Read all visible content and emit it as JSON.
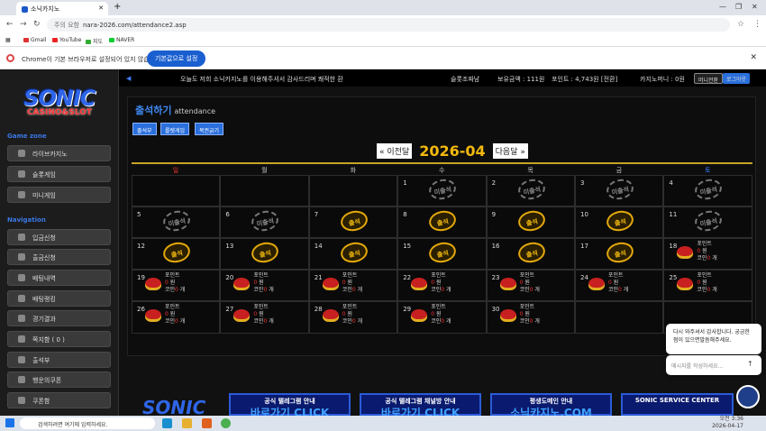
{
  "browser": {
    "tab_title": "소닉카지노",
    "url": "nara-2026.com/attendance2.asp",
    "security": "주의 요함"
  },
  "bookmarks": [
    "Gmail",
    "YouTube",
    "지도",
    "NAVER"
  ],
  "infobar": {
    "text": "Chrome이 기본 브라우저로 설정되어 있지 않습니다.",
    "button": "기본값으로 설정"
  },
  "logo": {
    "line1": "SONIC",
    "line2": "CASINO&SLOT"
  },
  "sidebar": {
    "game_zone_title": "Game zone",
    "game_items": [
      "라이브카지노",
      "슬롯게임",
      "미니게임"
    ],
    "nav_title": "Navigation",
    "nav_items": [
      "입금신청",
      "출금신청",
      "배팅내역",
      "배팅랭킹",
      "경기결과",
      "쪽지함 ( 0 )",
      "출석부",
      "행운의쿠폰",
      "쿠폰함"
    ]
  },
  "topbar": {
    "marquee": "오늘도 저희 소닉카지노를 이용해주셔서 감사드리며 쾌적한 환",
    "user": "슬롯조짜남",
    "balance": "보유금액 : 111원",
    "point": "포인트 : 4,743원 [전환]",
    "casino_money": "카지노머니 : 0원",
    "mini_btn": "머니전환",
    "logout_btn": "로그아웃"
  },
  "page": {
    "title": "출석하기",
    "subtitle": "attendance",
    "buttons": [
      "출석부",
      "룰렛게임",
      "복권긁기"
    ],
    "prev": "« 이전달",
    "month": "2026-04",
    "next": "다음달 »"
  },
  "calendar": {
    "weekdays": [
      "일",
      "월",
      "화",
      "수",
      "목",
      "금",
      "토"
    ],
    "weekday_colors": [
      "#e33",
      "#ccc",
      "#ccc",
      "#ccc",
      "#ccc",
      "#ccc",
      "#3f7fff"
    ],
    "absent_label": "미출석",
    "present_label": "출석",
    "reward": {
      "point": "포인트",
      "point_val": "0",
      "won": "원",
      "coin": "코인",
      "coin_val": "0",
      "count": "개"
    },
    "rows": [
      [
        null,
        null,
        null,
        {
          "d": "1",
          "s": "absent"
        },
        {
          "d": "2",
          "s": "absent"
        },
        {
          "d": "3",
          "s": "absent"
        },
        {
          "d": "4",
          "s": "absent"
        }
      ],
      [
        {
          "d": "5",
          "s": "absent"
        },
        {
          "d": "6",
          "s": "absent"
        },
        {
          "d": "7",
          "s": "present"
        },
        {
          "d": "8",
          "s": "present"
        },
        {
          "d": "9",
          "s": "present"
        },
        {
          "d": "10",
          "s": "present"
        },
        {
          "d": "11",
          "s": "absent"
        }
      ],
      [
        {
          "d": "12",
          "s": "present"
        },
        {
          "d": "13",
          "s": "present"
        },
        {
          "d": "14",
          "s": "present"
        },
        {
          "d": "15",
          "s": "present"
        },
        {
          "d": "16",
          "s": "present"
        },
        {
          "d": "17",
          "s": "present"
        },
        {
          "d": "18",
          "s": "reward"
        }
      ],
      [
        {
          "d": "19",
          "s": "reward"
        },
        {
          "d": "20",
          "s": "reward"
        },
        {
          "d": "21",
          "s": "reward"
        },
        {
          "d": "22",
          "s": "reward"
        },
        {
          "d": "23",
          "s": "reward"
        },
        {
          "d": "24",
          "s": "reward"
        },
        {
          "d": "25",
          "s": "reward"
        }
      ],
      [
        {
          "d": "26",
          "s": "reward"
        },
        {
          "d": "27",
          "s": "reward"
        },
        {
          "d": "28",
          "s": "reward"
        },
        {
          "d": "29",
          "s": "reward"
        },
        {
          "d": "30",
          "s": "reward"
        },
        null,
        null
      ]
    ]
  },
  "chat": {
    "message": "다시 와주셔서 감사합니다. 궁금한점이 있으면말씀해주세요.",
    "placeholder": "메시지를 작성하세요..."
  },
  "banners": [
    {
      "top": "공식 텔레그램 안내",
      "big": "바로가기 CLICK"
    },
    {
      "top": "공식 텔레그램 채널방 안내",
      "big": "바로가기 CLICK"
    },
    {
      "top": "평생도메인 안내",
      "big": "소닉카지노.COM"
    },
    {
      "top": "SONIC SERVICE CENTER",
      "big": ""
    }
  ],
  "taskbar": {
    "search": "검색하려면 여기에 입력하세요.",
    "time": "오전 3:36",
    "date": "2026-04-17"
  }
}
